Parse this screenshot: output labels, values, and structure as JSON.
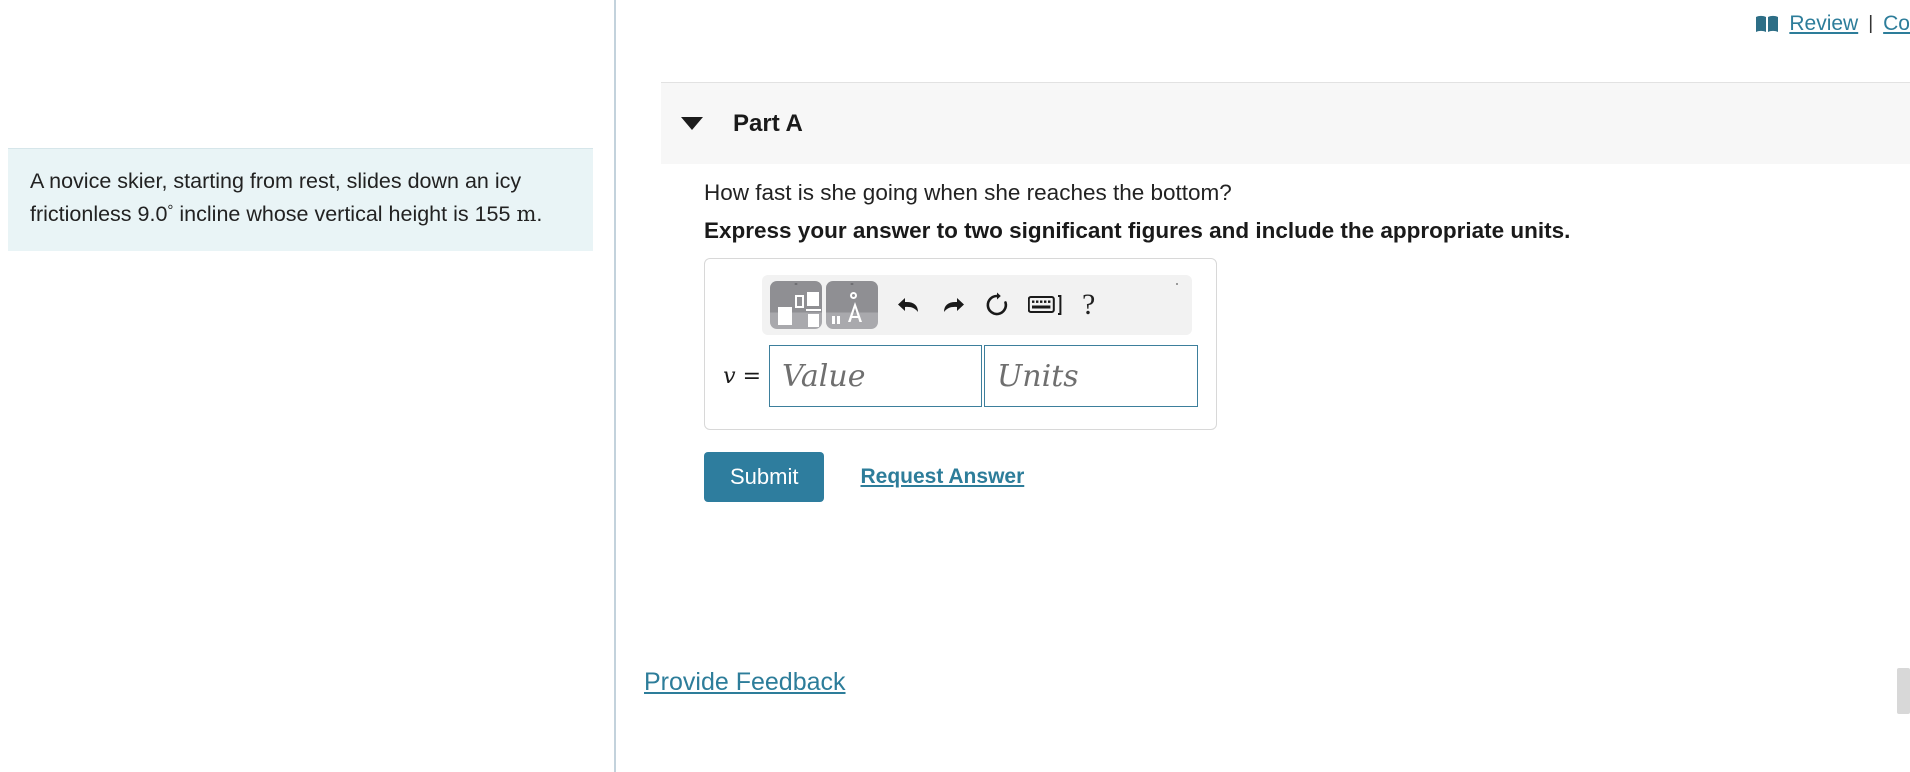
{
  "top": {
    "book_icon": "book-icon",
    "review_label": "Review",
    "separator": "|",
    "constants_label": "Co"
  },
  "problem": {
    "text_part1": "A novice skier, starting from rest, slides down an icy frictionless 9.0",
    "degree": "°",
    "text_part2": "incline whose vertical height is 155",
    "unit": "m",
    "period": "."
  },
  "part": {
    "caret_icon": "triangle-down-icon",
    "title": "Part A",
    "question": "How fast is she going when she reaches the bottom?",
    "instruction": "Express your answer to two significant figures and include the appropriate units."
  },
  "mathbar": {
    "template_button_label": "math-templates",
    "symbols_button_label": "greek-and-units",
    "undo_icon": "undo-arrow-icon",
    "redo_icon": "redo-arrow-icon",
    "reset_icon": "reset-circular-arrow-icon",
    "keyboard_icon": "keyboard-icon",
    "help_label": "?"
  },
  "answer": {
    "variable": "v =",
    "value_placeholder": "Value",
    "units_placeholder": "Units"
  },
  "actions": {
    "submit_label": "Submit",
    "request_answer_label": "Request Answer"
  },
  "footer": {
    "feedback_label": "Provide Feedback"
  },
  "colors": {
    "accent": "#2e7d9e",
    "link": "#2d7d9a",
    "problem_bg": "#e9f4f6",
    "part_header_bg": "#f7f7f7",
    "input_border": "#3d7f9c"
  }
}
